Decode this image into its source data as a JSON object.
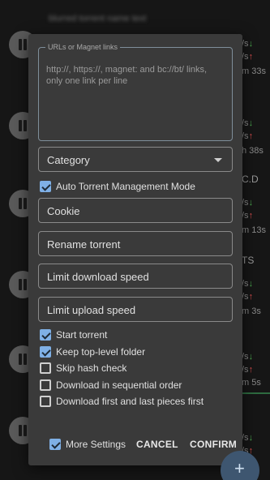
{
  "background": {
    "rows": [
      {
        "side": "/s",
        "eta": "m 33s"
      },
      {
        "side": "/s",
        "eta": "h 38s"
      },
      {
        "side": "/s",
        "eta": "m 13s",
        "tag": "C.D"
      },
      {
        "side": "/s",
        "eta": "m 3s",
        "tag": "TS"
      },
      {
        "side": "/s",
        "eta": "m 5s"
      },
      {
        "side": "/s",
        "eta": ""
      }
    ],
    "blurred_title": "blurred torrent name text"
  },
  "dialog": {
    "url_label": "URLs or Magnet links",
    "url_placeholder": "http://, https://, magnet: and bc://bt/ links, only one link per line",
    "category": "Category",
    "auto_tmm": "Auto Torrent Management Mode",
    "cookie": "Cookie",
    "rename": "Rename torrent",
    "limit_download": "Limit download speed",
    "limit_upload": "Limit upload speed",
    "checks": [
      {
        "label": "Start torrent",
        "checked": true
      },
      {
        "label": "Keep top-level folder",
        "checked": true
      },
      {
        "label": "Skip hash check",
        "checked": false
      },
      {
        "label": "Download in sequential order",
        "checked": false
      },
      {
        "label": "Download first and last pieces first",
        "checked": false
      }
    ],
    "more_settings": "More Settings",
    "cancel": "CANCEL",
    "confirm": "CONFIRM"
  },
  "fab_icon": "add-icon",
  "colors": {
    "accent": "#7fb0e6",
    "dialog_bg": "#3a3a3a",
    "fab": "#3e5670"
  }
}
